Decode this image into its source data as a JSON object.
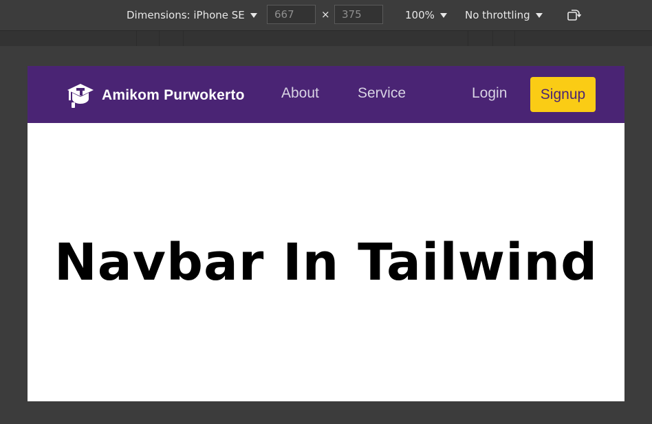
{
  "devtools": {
    "dimensions_label": "Dimensions: iPhone SE",
    "width_value": "667",
    "height_value": "375",
    "times_sign": "×",
    "zoom_label": "100%",
    "throttling_label": "No throttling",
    "rotate_icon": "rotate-icon"
  },
  "navbar": {
    "brand_name": "Amikom Purwokerto",
    "brand_icon": "graduation-cap-icon",
    "links": [
      "About",
      "Service"
    ],
    "login_label": "Login",
    "signup_label": "Signup",
    "colors": {
      "background": "#4a2474",
      "accent": "#facc15"
    }
  },
  "hero": {
    "title": "Navbar In Tailwind"
  }
}
